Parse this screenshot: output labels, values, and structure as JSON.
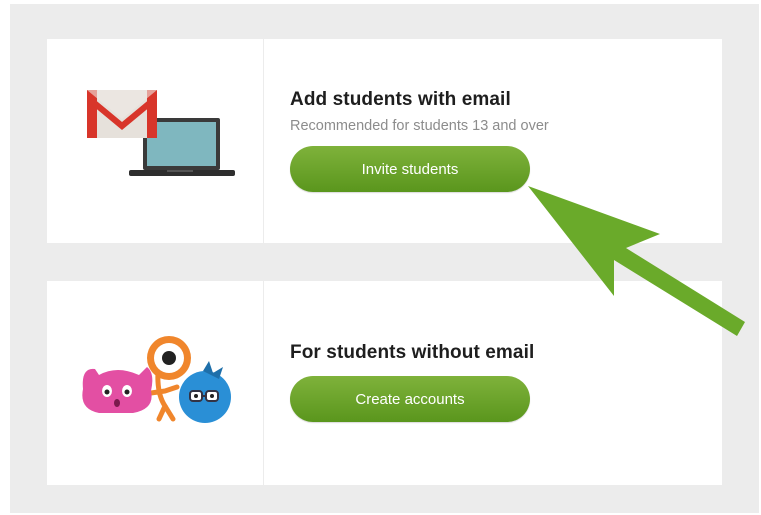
{
  "email_option": {
    "title": "Add students with email",
    "subtitle": "Recommended for students 13 and over",
    "button_label": "Invite students",
    "illustration_icons": [
      "gmail-envelope-icon",
      "laptop-icon"
    ]
  },
  "no_email_option": {
    "title": "For students without email",
    "button_label": "Create accounts",
    "illustration_icons": [
      "pink-monster-icon",
      "orange-monster-icon",
      "blue-monster-icon"
    ]
  },
  "annotation": {
    "arrow_color": "#6aaa2a",
    "points_to": "Invite students"
  },
  "colors": {
    "button_green": "#6aa32c",
    "background_gray": "#ececec",
    "title_text": "#1e1e1e",
    "subtitle_text": "#8c8c8c"
  }
}
